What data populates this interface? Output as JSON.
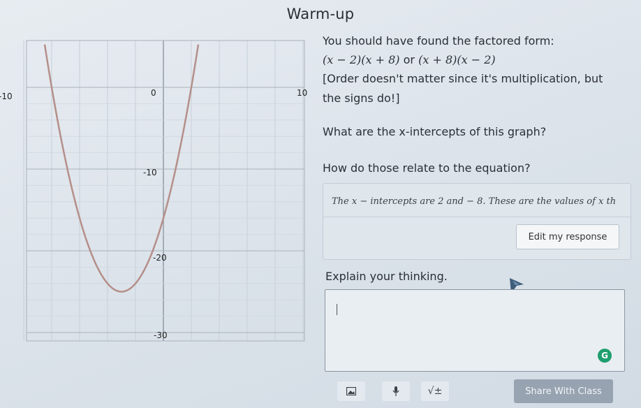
{
  "page": {
    "title": "Warm-up"
  },
  "graph": {
    "tick_labels": {
      "x_neg": "-10",
      "x_zero": "0",
      "x_pos": "10",
      "y_neg10": "-10",
      "y_neg20": "-20",
      "y_neg30": "-30"
    },
    "curve_color": "#b58f8a"
  },
  "content": {
    "line1": "You should have found the factored form:",
    "form_a": "(x − 2)(x + 8)",
    "or_text": "or",
    "form_b": "(x + 8)(x − 2)",
    "line3": "[Order doesn't matter since it's multiplication, but",
    "line4": "the signs do!]",
    "question1": "What are the x-intercepts of this graph?",
    "question2": "How do those relate to the equation?"
  },
  "response": {
    "text": "The x − intercepts are 2 and − 8. These are the values of x th",
    "edit_label": "Edit my response"
  },
  "explain": {
    "prompt": "Explain your thinking.",
    "value": "",
    "grammar_icon": "G"
  },
  "toolbar": {
    "image_icon": "image-icon",
    "mic_icon": "microphone-icon",
    "math_label": "√±",
    "share_label": "Share With Class"
  },
  "colors": {
    "accent": "#97a3b1",
    "grammar": "#1f9e6e",
    "pen": "#3e5d7a"
  }
}
